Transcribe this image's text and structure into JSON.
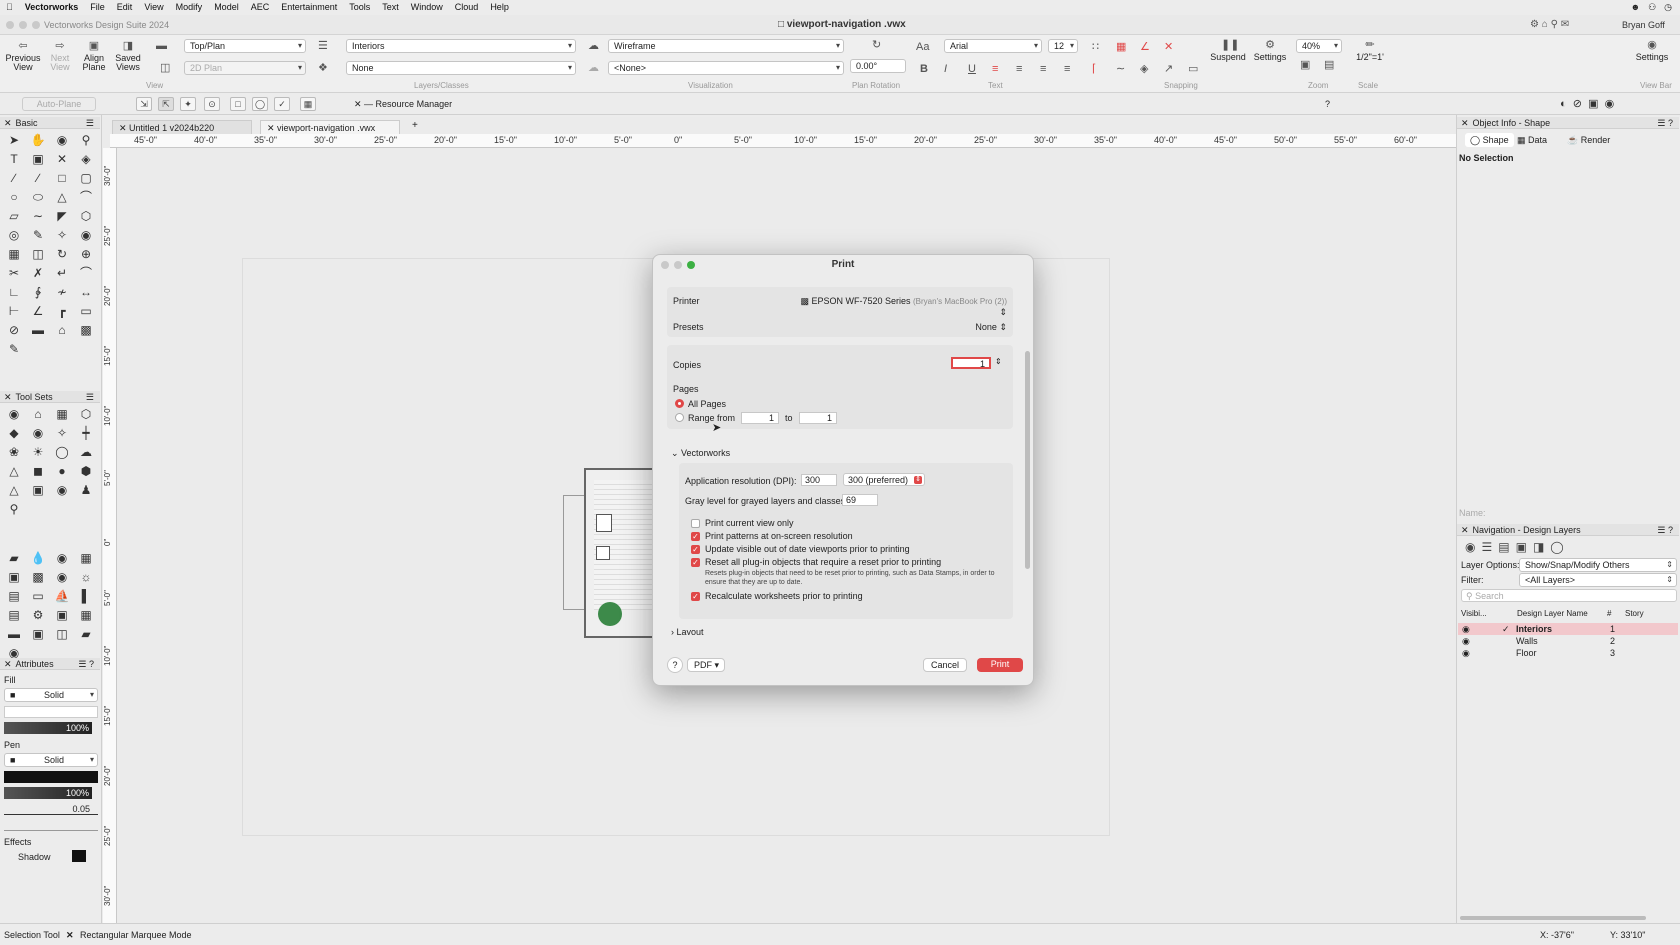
{
  "menubar": {
    "app": "Vectorworks",
    "items": [
      "File",
      "Edit",
      "View",
      "Modify",
      "Model",
      "AEC",
      "Entertainment",
      "Tools",
      "Text",
      "Window",
      "Cloud",
      "Help"
    ]
  },
  "window": {
    "app_title": "Vectorworks Design Suite 2024",
    "doc_title": "viewport-navigation .vwx",
    "user": "Bryan Goff"
  },
  "toolbar": {
    "previous_view": "Previous View",
    "next_view": "Next View",
    "align_plane": "Align Plane",
    "saved_views": "Saved Views",
    "view_mode": "Top/Plan",
    "plan_mode": "2D Plan",
    "view_group": "View",
    "layer": "Interiors",
    "class": "None",
    "layers_group": "Layers/Classes",
    "render_mode": "Wireframe",
    "render_mode_2": "<None>",
    "visualization_group": "Visualization",
    "plan_rotation": "0.00°",
    "plan_rotation_group": "Plan Rotation",
    "font": "Arial",
    "font_size": "12",
    "text_group": "Text",
    "snapping_group": "Snapping",
    "suspend": "Suspend",
    "settings": "Settings",
    "zoom_value": "40%",
    "zoom_group": "Zoom",
    "scale": "1/2\"=1'",
    "scale_group": "Scale",
    "settings_right": "Settings",
    "view_bar": "View Bar"
  },
  "modebar": {
    "auto_plane": "Auto-Plane",
    "resource_manager": "Resource Manager"
  },
  "palettes": {
    "basic": "Basic",
    "tool_sets": "Tool Sets",
    "attributes": "Attributes",
    "fill_label": "Fill",
    "fill_style": "Solid",
    "fill_opacity": "100%",
    "pen_label": "Pen",
    "pen_style": "Solid",
    "pen_opacity": "100%",
    "line_weight": "0.05",
    "effects_label": "Effects",
    "shadow_label": "Shadow"
  },
  "doc_tabs": [
    "Untitled 1 v2024b220",
    "viewport-navigation .vwx"
  ],
  "ruler_h": [
    "45'-0\"",
    "40'-0\"",
    "35'-0\"",
    "30'-0\"",
    "25'-0\"",
    "20'-0\"",
    "15'-0\"",
    "10'-0\"",
    "5'-0\"",
    "0\"",
    "5'-0\"",
    "10'-0\"",
    "15'-0\"",
    "20'-0\"",
    "25'-0\"",
    "30'-0\"",
    "35'-0\"",
    "40'-0\"",
    "45'-0\"",
    "50'-0\"",
    "55'-0\"",
    "60'-0\""
  ],
  "ruler_v": [
    "30'-0\"",
    "25'-0\"",
    "20'-0\"",
    "15'-0\"",
    "10'-0\"",
    "5'-0\"",
    "0\"",
    "5'-0\"",
    "10'-0\"",
    "15'-0\"",
    "20'-0\"",
    "25'-0\"",
    "30'-0\""
  ],
  "print_dialog": {
    "title": "Print",
    "printer_label": "Printer",
    "printer_value": "EPSON WF-7520 Series",
    "printer_host": "(Bryan's MacBook Pro (2))",
    "presets_label": "Presets",
    "presets_value": "None",
    "copies_label": "Copies",
    "copies_value": "1",
    "pages_label": "Pages",
    "all_pages": "All Pages",
    "range_from": "Range from",
    "range_start": "1",
    "range_to": "to",
    "range_end": "1",
    "section_vectorworks": "Vectorworks",
    "app_resolution_label": "Application resolution (DPI):",
    "app_resolution_value": "300",
    "app_resolution_select": "300 (preferred)",
    "gray_level_label": "Gray level for grayed layers and classes:",
    "gray_level_value": "69",
    "opt_current_view": "Print current view only",
    "opt_patterns": "Print patterns at on-screen resolution",
    "opt_viewports": "Update visible out of date viewports prior to printing",
    "opt_reset_plugins": "Reset all plug-in objects that require a reset prior to printing",
    "opt_reset_note": "Resets plug-in objects that need to be reset prior to printing, such as Data Stamps, in order to ensure that they are up to date.",
    "opt_worksheets": "Recalculate worksheets prior to printing",
    "section_layout": "Layout",
    "help": "?",
    "pdf": "PDF",
    "cancel": "Cancel",
    "print": "Print"
  },
  "object_info": {
    "title": "Object Info - Shape",
    "tab_shape": "Shape",
    "tab_data": "Data",
    "tab_render": "Render",
    "selection": "No Selection",
    "name_placeholder": "Name:"
  },
  "navigation": {
    "title": "Navigation - Design Layers",
    "layer_options_label": "Layer Options:",
    "layer_options_value": "Show/Snap/Modify Others",
    "filter_label": "Filter:",
    "filter_value": "<All Layers>",
    "search_placeholder": "Search",
    "col_visibility": "Visibi...",
    "col_name": "Design Layer Name",
    "col_num": "#",
    "col_story": "Story",
    "layers": [
      {
        "name": "Interiors",
        "num": "1"
      },
      {
        "name": "Walls",
        "num": "2"
      },
      {
        "name": "Floor",
        "num": "3"
      }
    ]
  },
  "statusbar": {
    "tool": "Selection Tool",
    "mode": "Rectangular Marquee Mode",
    "x_coord": "X: -37'6\"",
    "y_coord": "Y: 33'10\""
  },
  "colors": {
    "accent_red": "#e04848",
    "active_layer_bg": "#f2c8cc"
  }
}
